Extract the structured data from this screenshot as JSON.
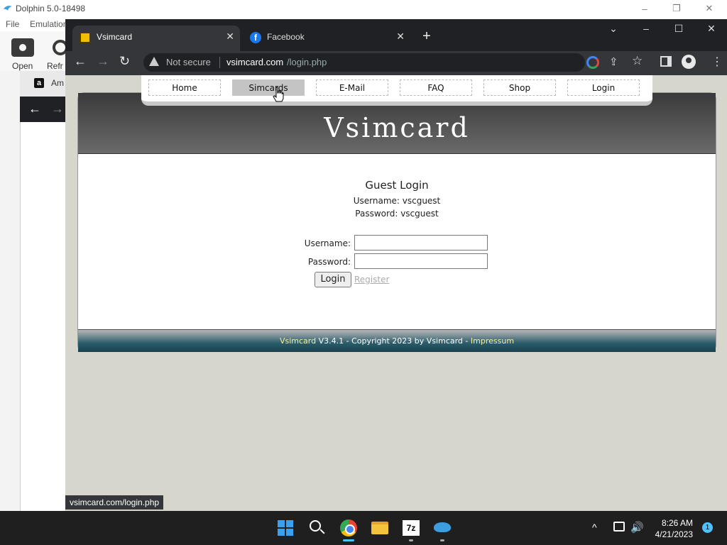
{
  "dolphin": {
    "title": "Dolphin 5.0-18498",
    "menu": [
      "File",
      "Emulation"
    ],
    "toolbar": {
      "open_label": "Open",
      "refresh_label": "Refr"
    },
    "window_controls": {
      "minimize": "–",
      "restore": "❐",
      "close": "✕"
    }
  },
  "amazon_window": {
    "tab_title": "Am",
    "favicon": "a"
  },
  "chrome": {
    "tabs": [
      {
        "title": "Vsimcard",
        "close": "✕"
      },
      {
        "title": "Facebook",
        "close": "✕",
        "favicon": "f"
      }
    ],
    "newtab": "+",
    "window_controls": {
      "dropdown": "⌄",
      "minimize": "–",
      "maximize": "☐",
      "close": "✕"
    },
    "nav": {
      "back": "←",
      "forward": "→",
      "reload": "↻"
    },
    "omnibox": {
      "security_label": "Not secure",
      "url_host": "vsimcard.com",
      "url_path": "/login.php"
    },
    "icons": {
      "share": "⇪",
      "star": "☆",
      "menu": "⋮"
    },
    "status_url": "vsimcard.com/login.php"
  },
  "site": {
    "nav": [
      "Home",
      "Simcards",
      "E-Mail",
      "FAQ",
      "Shop",
      "Login"
    ],
    "active_nav": "Simcards",
    "title": "Vsimcard",
    "guest": {
      "title": "Guest Login",
      "username_line": "Username:  vscguest",
      "password_line": "Password:   vscguest"
    },
    "form": {
      "username_label": "Username:",
      "password_label": "Password:",
      "username_value": "",
      "password_value": "",
      "login_button": "Login",
      "register_link": "Register"
    },
    "footer": {
      "brand": "Vsimcard",
      "middle": " V3.4.1 - Copyright 2023 by Vsimcard - ",
      "impressum": "Impressum"
    }
  },
  "taskbar": {
    "sevenzip_label": "7z",
    "tray_chevron": "^",
    "volume": "🔊",
    "time": "8:26 AM",
    "date": "4/21/2023",
    "notification_count": "1"
  },
  "colors": {
    "chrome_dark": "#202124",
    "header_gradient_top": "#3a3a3a",
    "footer_teal": "#2a5c6a",
    "footer_highlight": "#f6f0a0",
    "taskbar": "#1f1f1f"
  }
}
